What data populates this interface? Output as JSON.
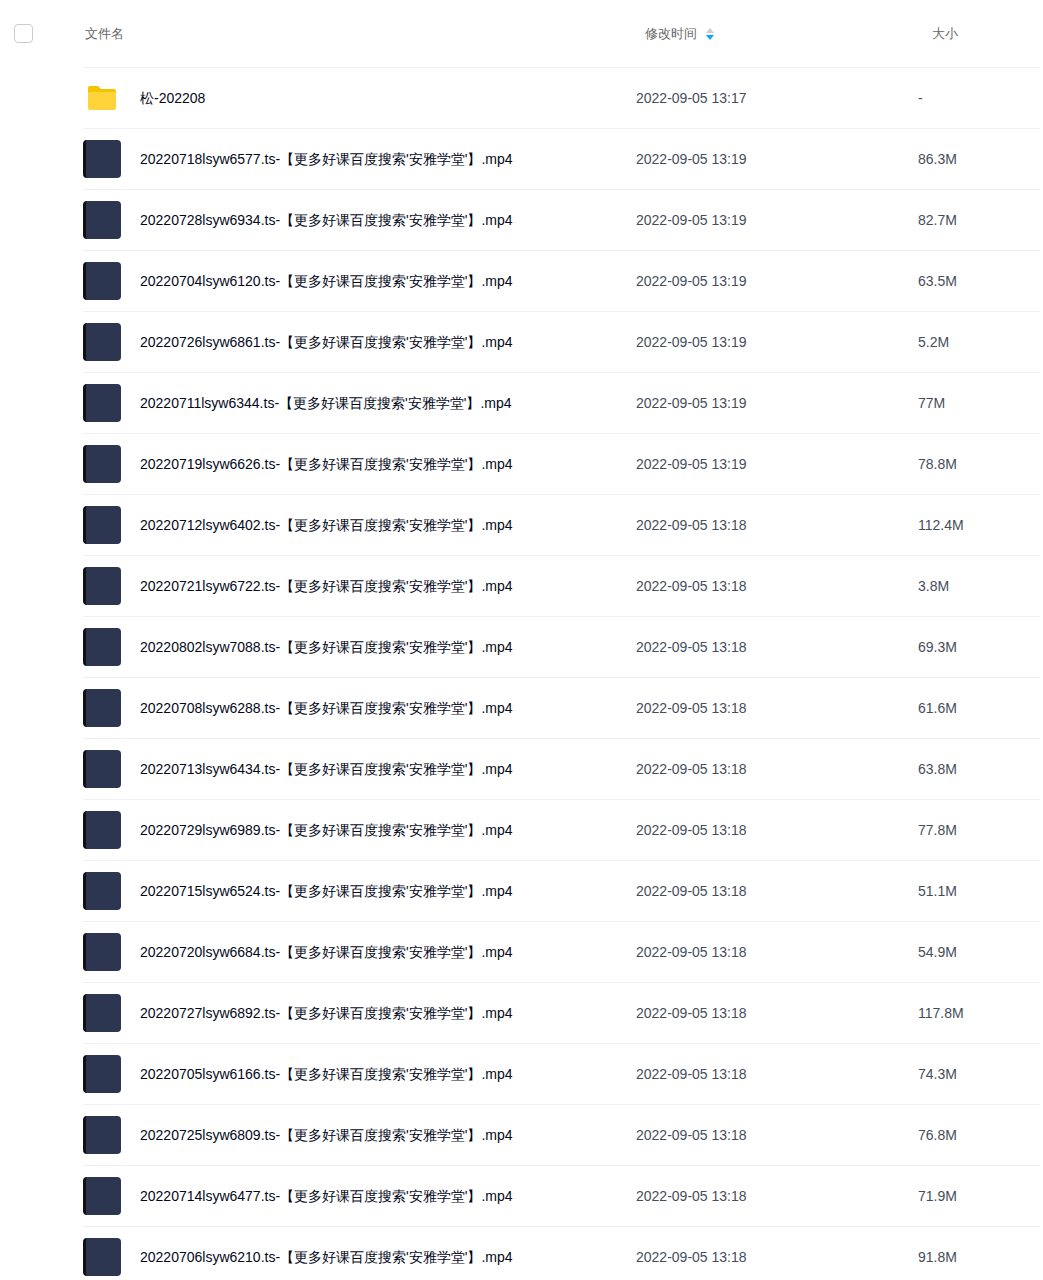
{
  "select_all": {
    "checked": false
  },
  "columns": [
    {
      "label": "文件名",
      "sorted": false
    },
    {
      "label": "修改时间",
      "sorted": true
    },
    {
      "label": "大小",
      "sorted": false
    }
  ],
  "files": [
    {
      "kind": "folder",
      "name": "松-202208",
      "time": "2022-09-05 13:17",
      "size": "-"
    },
    {
      "kind": "video",
      "name": "20220718lsyw6577.ts-【更多好课百度搜索'安雅学堂'】.mp4",
      "time": "2022-09-05 13:19",
      "size": "86.3M"
    },
    {
      "kind": "video",
      "name": "20220728lsyw6934.ts-【更多好课百度搜索'安雅学堂'】.mp4",
      "time": "2022-09-05 13:19",
      "size": "82.7M"
    },
    {
      "kind": "video",
      "name": "20220704lsyw6120.ts-【更多好课百度搜索'安雅学堂'】.mp4",
      "time": "2022-09-05 13:19",
      "size": "63.5M"
    },
    {
      "kind": "video",
      "name": "20220726lsyw6861.ts-【更多好课百度搜索'安雅学堂'】.mp4",
      "time": "2022-09-05 13:19",
      "size": "5.2M"
    },
    {
      "kind": "video",
      "name": "20220711lsyw6344.ts-【更多好课百度搜索'安雅学堂'】.mp4",
      "time": "2022-09-05 13:19",
      "size": "77M"
    },
    {
      "kind": "video",
      "name": "20220719lsyw6626.ts-【更多好课百度搜索'安雅学堂'】.mp4",
      "time": "2022-09-05 13:19",
      "size": "78.8M"
    },
    {
      "kind": "video",
      "name": "20220712lsyw6402.ts-【更多好课百度搜索'安雅学堂'】.mp4",
      "time": "2022-09-05 13:18",
      "size": "112.4M"
    },
    {
      "kind": "video",
      "name": "20220721lsyw6722.ts-【更多好课百度搜索'安雅学堂'】.mp4",
      "time": "2022-09-05 13:18",
      "size": "3.8M"
    },
    {
      "kind": "video",
      "name": "20220802lsyw7088.ts-【更多好课百度搜索'安雅学堂'】.mp4",
      "time": "2022-09-05 13:18",
      "size": "69.3M"
    },
    {
      "kind": "video",
      "name": "20220708lsyw6288.ts-【更多好课百度搜索'安雅学堂'】.mp4",
      "time": "2022-09-05 13:18",
      "size": "61.6M"
    },
    {
      "kind": "video",
      "name": "20220713lsyw6434.ts-【更多好课百度搜索'安雅学堂'】.mp4",
      "time": "2022-09-05 13:18",
      "size": "63.8M"
    },
    {
      "kind": "video",
      "name": "20220729lsyw6989.ts-【更多好课百度搜索'安雅学堂'】.mp4",
      "time": "2022-09-05 13:18",
      "size": "77.8M"
    },
    {
      "kind": "video",
      "name": "20220715lsyw6524.ts-【更多好课百度搜索'安雅学堂'】.mp4",
      "time": "2022-09-05 13:18",
      "size": "51.1M"
    },
    {
      "kind": "video",
      "name": "20220720lsyw6684.ts-【更多好课百度搜索'安雅学堂'】.mp4",
      "time": "2022-09-05 13:18",
      "size": "54.9M"
    },
    {
      "kind": "video",
      "name": "20220727lsyw6892.ts-【更多好课百度搜索'安雅学堂'】.mp4",
      "time": "2022-09-05 13:18",
      "size": "117.8M"
    },
    {
      "kind": "video",
      "name": "20220705lsyw6166.ts-【更多好课百度搜索'安雅学堂'】.mp4",
      "time": "2022-09-05 13:18",
      "size": "74.3M"
    },
    {
      "kind": "video",
      "name": "20220725lsyw6809.ts-【更多好课百度搜索'安雅学堂'】.mp4",
      "time": "2022-09-05 13:18",
      "size": "76.8M"
    },
    {
      "kind": "video",
      "name": "20220714lsyw6477.ts-【更多好课百度搜索'安雅学堂'】.mp4",
      "time": "2022-09-05 13:18",
      "size": "71.9M"
    },
    {
      "kind": "video",
      "name": "20220706lsyw6210.ts-【更多好课百度搜索'安雅学堂'】.mp4",
      "time": "2022-09-05 13:18",
      "size": "91.8M"
    }
  ]
}
